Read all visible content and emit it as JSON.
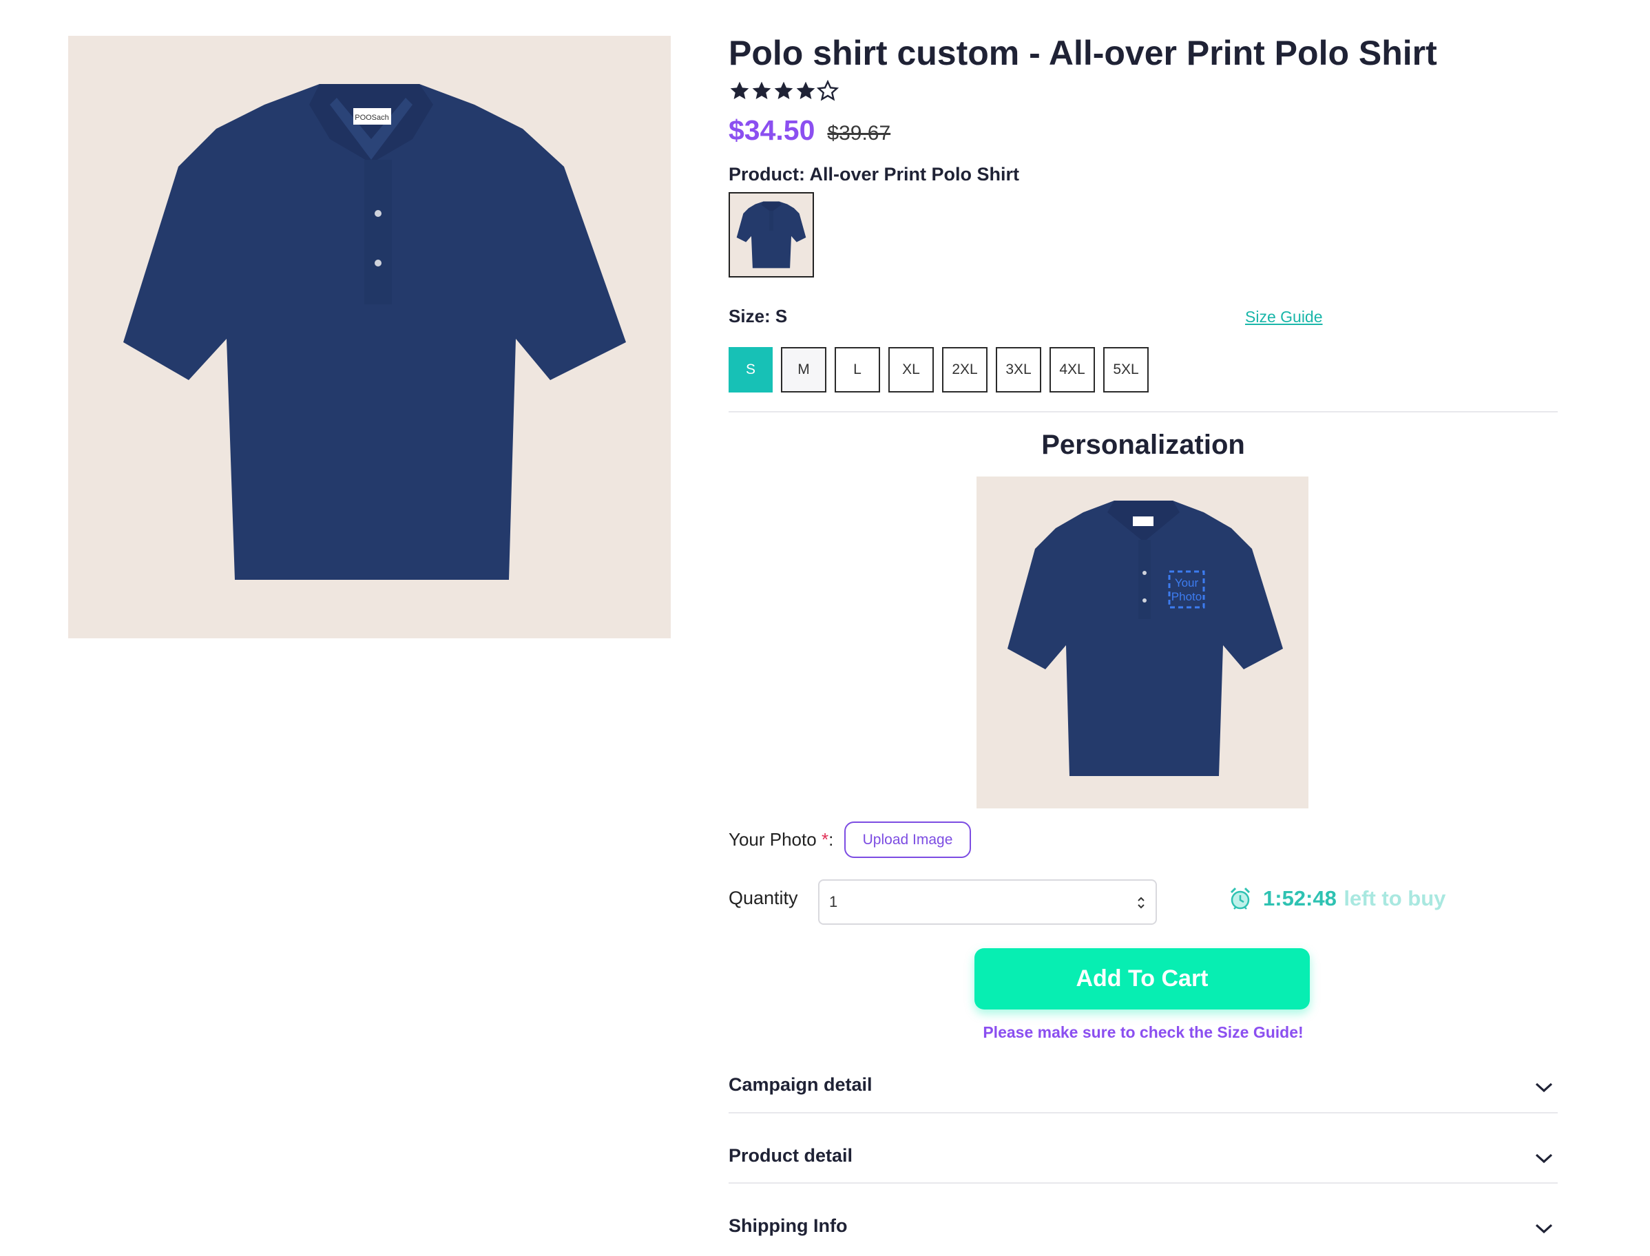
{
  "product": {
    "title": "Polo shirt custom - All-over Print Polo Shirt",
    "rating": 4,
    "rating_max": 5,
    "price": "$34.50",
    "old_price": "$39.67",
    "product_label": "Product:",
    "product_value": "All-over Print Polo Shirt",
    "shirt_tag": "POOSach"
  },
  "size": {
    "label": "Size:",
    "selected": "S",
    "guide_link": "Size Guide",
    "options": [
      "S",
      "M",
      "L",
      "XL",
      "2XL",
      "3XL",
      "4XL",
      "5XL"
    ]
  },
  "personalization": {
    "title": "Personalization",
    "placeholder_text_line1": "Your",
    "placeholder_text_line2": "Photo",
    "photo_label": "Your Photo ",
    "required_mark": "*",
    "photo_suffix": ":",
    "upload_label": "Upload Image"
  },
  "purchase": {
    "quantity_label": "Quantity",
    "quantity_value": "1",
    "timer_time": "1:52:48",
    "timer_suffix": "left to buy",
    "add_to_cart": "Add To Cart",
    "note": "Please make sure to check the Size Guide!"
  },
  "accordions": [
    {
      "label": "Campaign detail"
    },
    {
      "label": "Product detail"
    },
    {
      "label": "Shipping Info"
    }
  ],
  "colors": {
    "accent_purple": "#8b4ff0",
    "accent_teal": "#17c1b6",
    "cart_green": "#07eeb2",
    "shirt_navy": "#243a6b"
  },
  "icons": [
    "star-icon",
    "alarm-clock-icon",
    "chevron-down-icon",
    "select-arrows-icon"
  ]
}
